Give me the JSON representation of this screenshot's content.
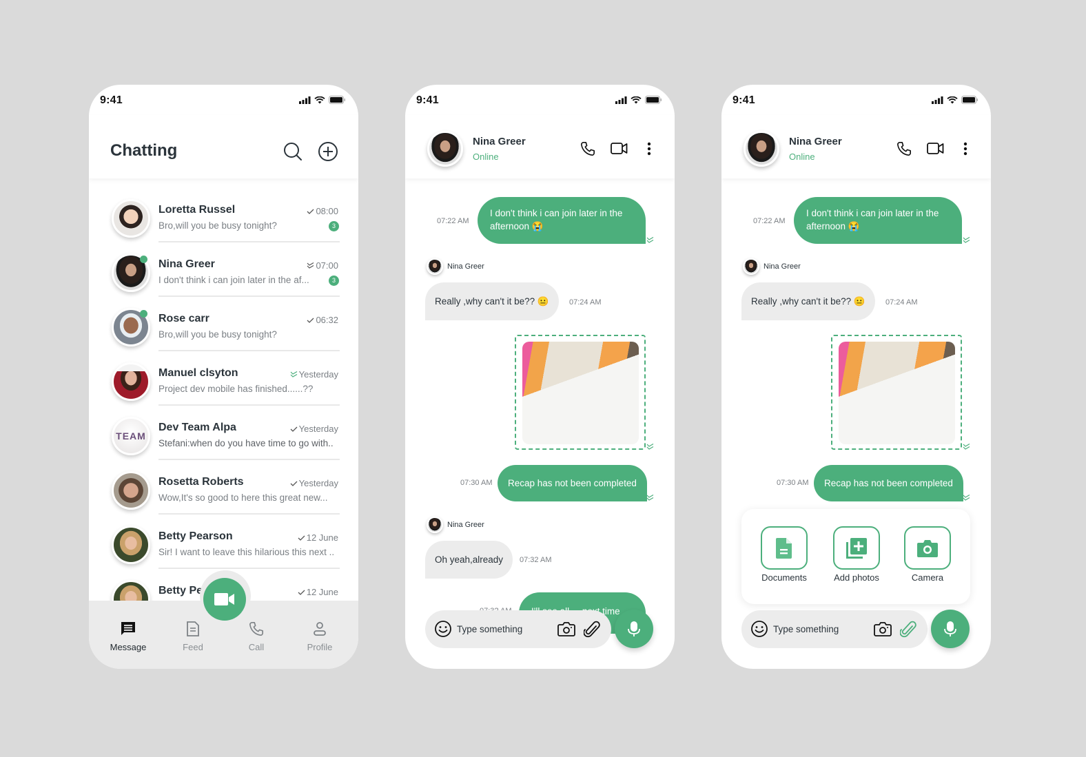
{
  "colors": {
    "accent": "#4caf7c",
    "background": "#dadada",
    "bubble_in": "#ececec",
    "nav_bg": "#ebebeb"
  },
  "status_bar": {
    "time": "9:41"
  },
  "chat_list_screen": {
    "title": "Chatting",
    "header_icons": [
      "search-icon",
      "add-circle-icon"
    ],
    "chats": [
      {
        "name": "Loretta Russel",
        "preview": "Bro,will you be busy tonight?",
        "time": "08:00",
        "check": "single",
        "unread": "3",
        "online": false
      },
      {
        "name": "Nina Greer",
        "preview": "I don't think i can join later in the af...",
        "time": "07:00",
        "check": "double",
        "unread": "3",
        "online": true
      },
      {
        "name": "Rose carr",
        "preview": "Bro,will you be busy tonight?",
        "time": "06:32",
        "check": "single",
        "unread": null,
        "online": true
      },
      {
        "name": "Manuel clsyton",
        "preview": "Project dev mobile has finished......??",
        "time": "Yesterday",
        "check": "double-green",
        "unread": null,
        "online": false
      },
      {
        "name": "Dev Team Alpa",
        "preview": "Stefani:when do you have time to go with..",
        "time": "Yesterday",
        "check": "single",
        "unread": null,
        "online": false,
        "avatar_text": "TEAM"
      },
      {
        "name": "Rosetta Roberts",
        "preview": "Wow,It's so good to here this great new...",
        "time": "Yesterday",
        "check": "single",
        "unread": null,
        "online": false
      },
      {
        "name": "Betty Pearson",
        "preview": "Sir! I want to leave this hilarious this next ..",
        "time": "12 June",
        "check": "single",
        "unread": null,
        "online": false
      },
      {
        "name": "Betty Pearson",
        "preview": "",
        "time": "12 June",
        "check": "single",
        "unread": null,
        "online": false
      }
    ],
    "nav": [
      {
        "label": "Message",
        "icon": "message-icon",
        "active": true
      },
      {
        "label": "Feed",
        "icon": "feed-icon",
        "active": false
      },
      {
        "label": "Call",
        "icon": "phone-icon",
        "active": false
      },
      {
        "label": "Profile",
        "icon": "profile-icon",
        "active": false
      }
    ],
    "fab_icon": "video-camera-icon"
  },
  "conversation": {
    "contact_name": "Nina Greer",
    "contact_status": "Online",
    "messages": [
      {
        "direction": "out",
        "text": "I don't think i can join later in the afternoon",
        "emoji": "😭",
        "time": "07:22 AM"
      },
      {
        "direction": "in",
        "sender": "Nina Greer",
        "text": "Really ,why can't it be??",
        "emoji": "😐",
        "time": "07:24 AM"
      },
      {
        "direction": "out",
        "type": "image",
        "image_alt": "Wireframe sketches on a table"
      },
      {
        "direction": "out",
        "text": "Recap has not been completed",
        "time": "07:30 AM"
      },
      {
        "direction": "in",
        "sender": "Nina Greer",
        "text": "Oh yeah,already",
        "time": "07:32 AM"
      },
      {
        "direction": "out",
        "text": "I'll see all ... next time",
        "time": "07:3? AM"
      }
    ],
    "composer_placeholder": "Type something"
  },
  "attach_panel": {
    "options": [
      {
        "label": "Documents",
        "icon": "document-icon"
      },
      {
        "label": "Add photos",
        "icon": "add-photos-icon"
      },
      {
        "label": "Camera",
        "icon": "camera-icon"
      }
    ]
  }
}
